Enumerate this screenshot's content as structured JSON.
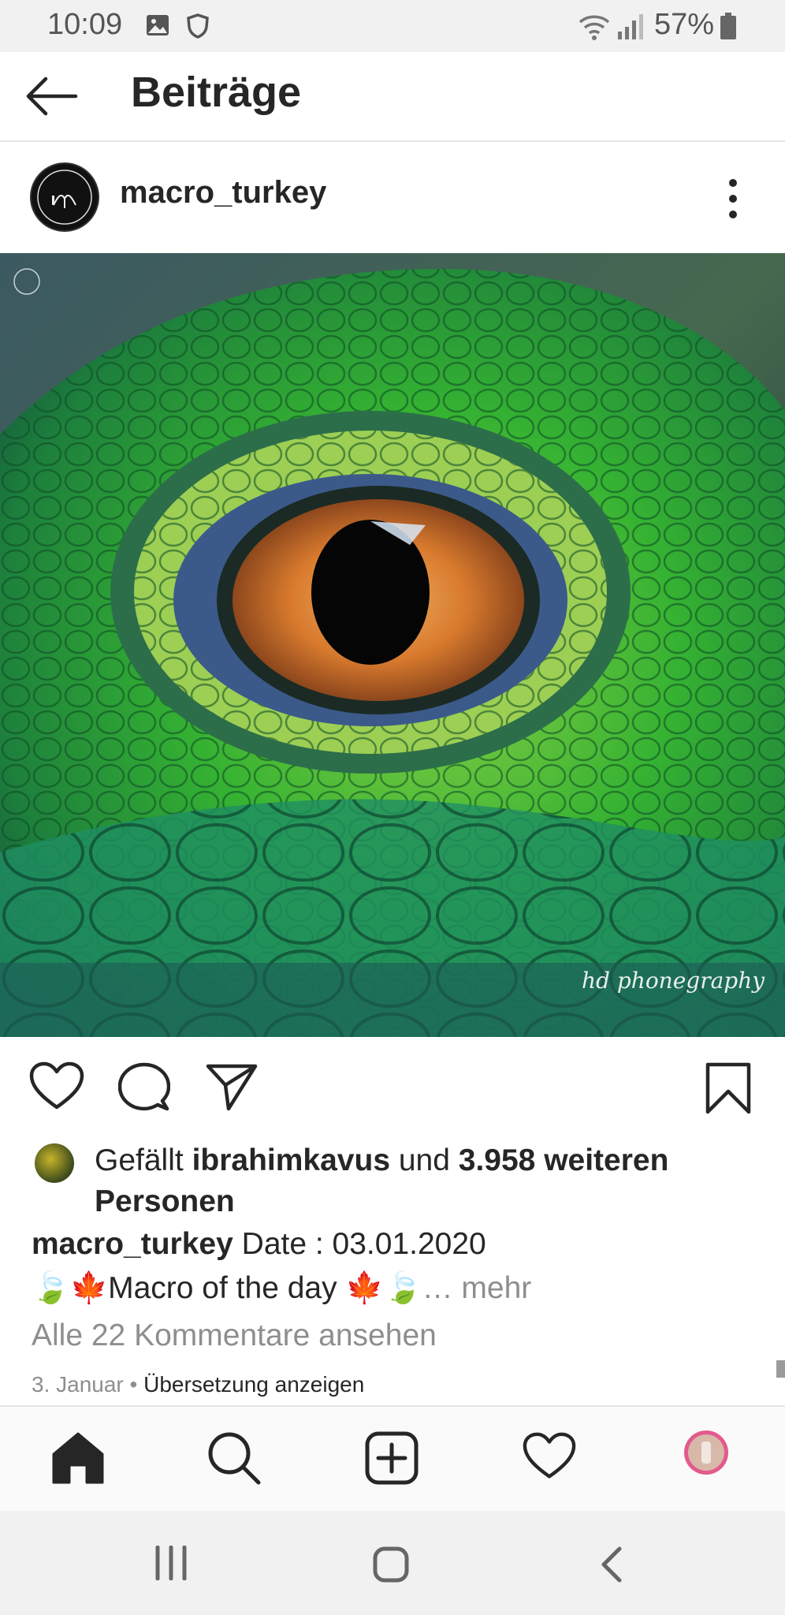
{
  "status_bar": {
    "time": "10:09",
    "battery_percent": "57%",
    "icons": [
      "image-icon",
      "shield-icon",
      "wifi-icon",
      "signal-icon",
      "battery-icon"
    ]
  },
  "header": {
    "title": "Beiträge",
    "back_icon": "arrow-left-icon"
  },
  "post": {
    "username": "macro_turkey",
    "more_icon": "more-vertical-icon",
    "photo_watermark": "hd phonegraphy",
    "actions": [
      "heart-icon",
      "comment-icon",
      "share-icon",
      "bookmark-icon"
    ],
    "likes": {
      "prefix": "Gefällt ",
      "user": "ibrahimkavus",
      "middle": " und ",
      "count_text": "3.958 weiteren Personen"
    },
    "caption": {
      "username": "macro_turkey",
      "text": " Date : 03.01.2020",
      "line2": "🍃🍁Macro of the day 🍁🍃",
      "more": "… mehr"
    },
    "comments_link": "Alle 22 Kommentare ansehen",
    "date": "3. Januar",
    "separator": " • ",
    "translate": "Übersetzung anzeigen"
  },
  "bottom_nav": [
    "home-icon",
    "search-icon",
    "add-post-icon",
    "activity-heart-icon",
    "profile-avatar"
  ],
  "system_nav": [
    "recent-apps-icon",
    "home-button-icon",
    "back-nav-icon"
  ],
  "colors": {
    "text": "#262626",
    "muted": "#8e8e8e",
    "status_bar": "#f1f1f1"
  }
}
